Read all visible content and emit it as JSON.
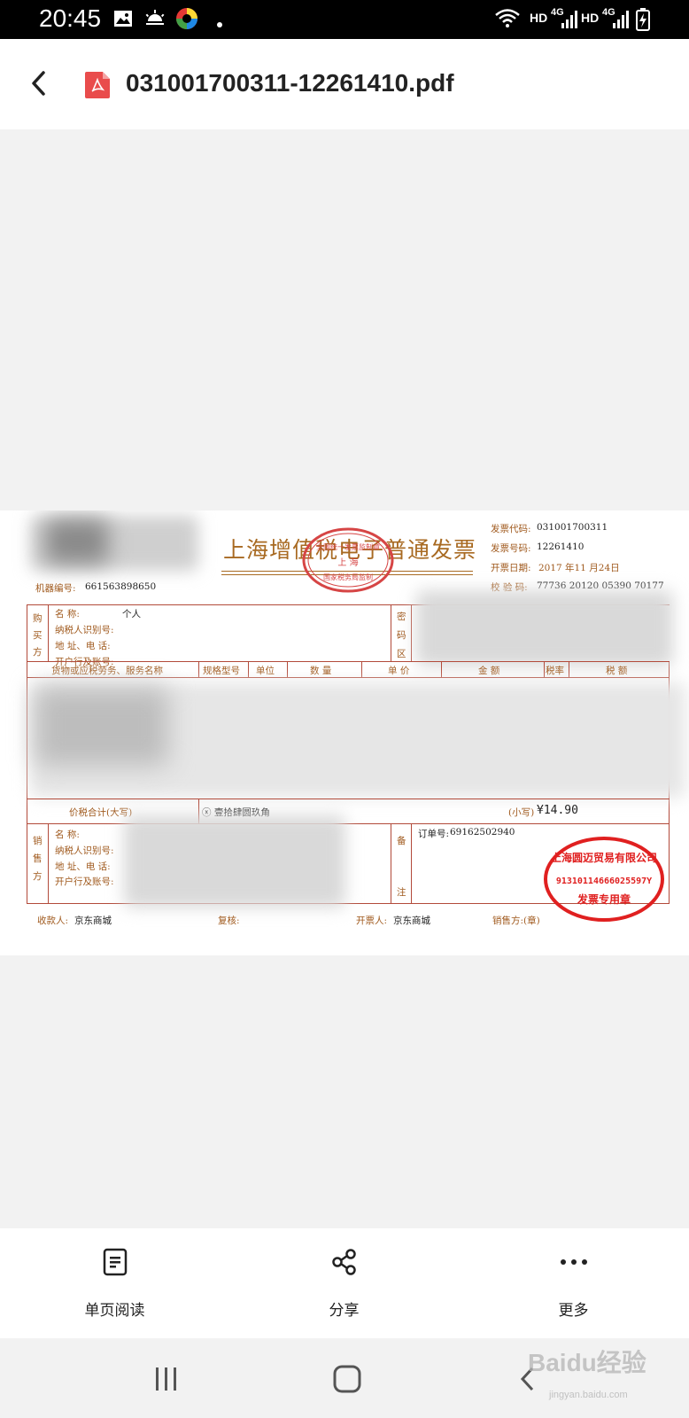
{
  "status_bar": {
    "time": "20:45",
    "icons": [
      "gallery-icon",
      "weather-icon",
      "app-icon",
      "dot-icon",
      "wifi-icon",
      "signal-icon",
      "battery-icon"
    ],
    "hd1": "HD",
    "net1": "4G",
    "hd2": "HD",
    "net2": "4G"
  },
  "header": {
    "back_icon": "chevron-left-icon",
    "file_icon": "pdf-icon",
    "file_name": "031001700311-12261410.pdf"
  },
  "invoice": {
    "title": "上海增值税电子普通发票",
    "code_label": "发票代码:",
    "code": "031001700311",
    "number_label": "发票号码:",
    "number": "12261410",
    "date_label": "开票日期:",
    "date": "2017 年11 月24日",
    "check_label": "校  验  码:",
    "check_code": "77736 20120 05390 70177",
    "machine_label": "机器编号:",
    "machine_no": "661563898650",
    "buyer": {
      "section": [
        "购",
        "买",
        "方"
      ],
      "name_label": "名          称:",
      "name_value": "个人",
      "tax_label": "纳税人识别号:",
      "addr_label": "地  址、电  话:",
      "bank_label": "开户行及账号:"
    },
    "cipher_section": [
      "密",
      "码",
      "区"
    ],
    "columns": [
      "货物或应税劳务、服务名称",
      "规格型号",
      "单位",
      "数  量",
      "单  价",
      "金  额",
      "税率",
      "税  额"
    ],
    "total_label": "价税合计(大写)",
    "total_capital": "ⓧ 壹拾肆圆玖角",
    "total_small_label": "(小写)",
    "total_small": "¥14.90",
    "seller": {
      "section": [
        "销",
        "售",
        "方"
      ],
      "name_label": "名          称:",
      "tax_label": "纳税人识别号:",
      "addr_label": "地  址、电  话:",
      "bank_label": "开户行及账号:"
    },
    "remark_section": [
      "备",
      "注"
    ],
    "order_label": "订单号:",
    "order_no": "69162502940",
    "payee_label": "收款人:",
    "payee": "京东商城",
    "reviewer_label": "复核:",
    "issuer_label": "开票人:",
    "issuer": "京东商城",
    "seller_stamp_label": "销售方:(章)",
    "seal_top_text": "全国统一发票监制章",
    "seal_center_text": "上  海",
    "seal_bottom_text": "国家税务局监制",
    "company_seal_text": "上海圆迈贸易有限公司",
    "company_seal_id": "91310114666025597Y",
    "company_seal_sub": "发票专用章"
  },
  "toolbar": {
    "items": [
      {
        "label": "单页阅读",
        "icon": "document-icon"
      },
      {
        "label": "分享",
        "icon": "share-icon"
      },
      {
        "label": "更多",
        "icon": "more-icon"
      }
    ]
  },
  "nav": {
    "recent_icon": "recent-apps-icon",
    "home_icon": "home-icon",
    "back_icon": "back-icon"
  },
  "watermark": {
    "text": "Baidu经验",
    "sub": "jingyan.baidu.com"
  }
}
